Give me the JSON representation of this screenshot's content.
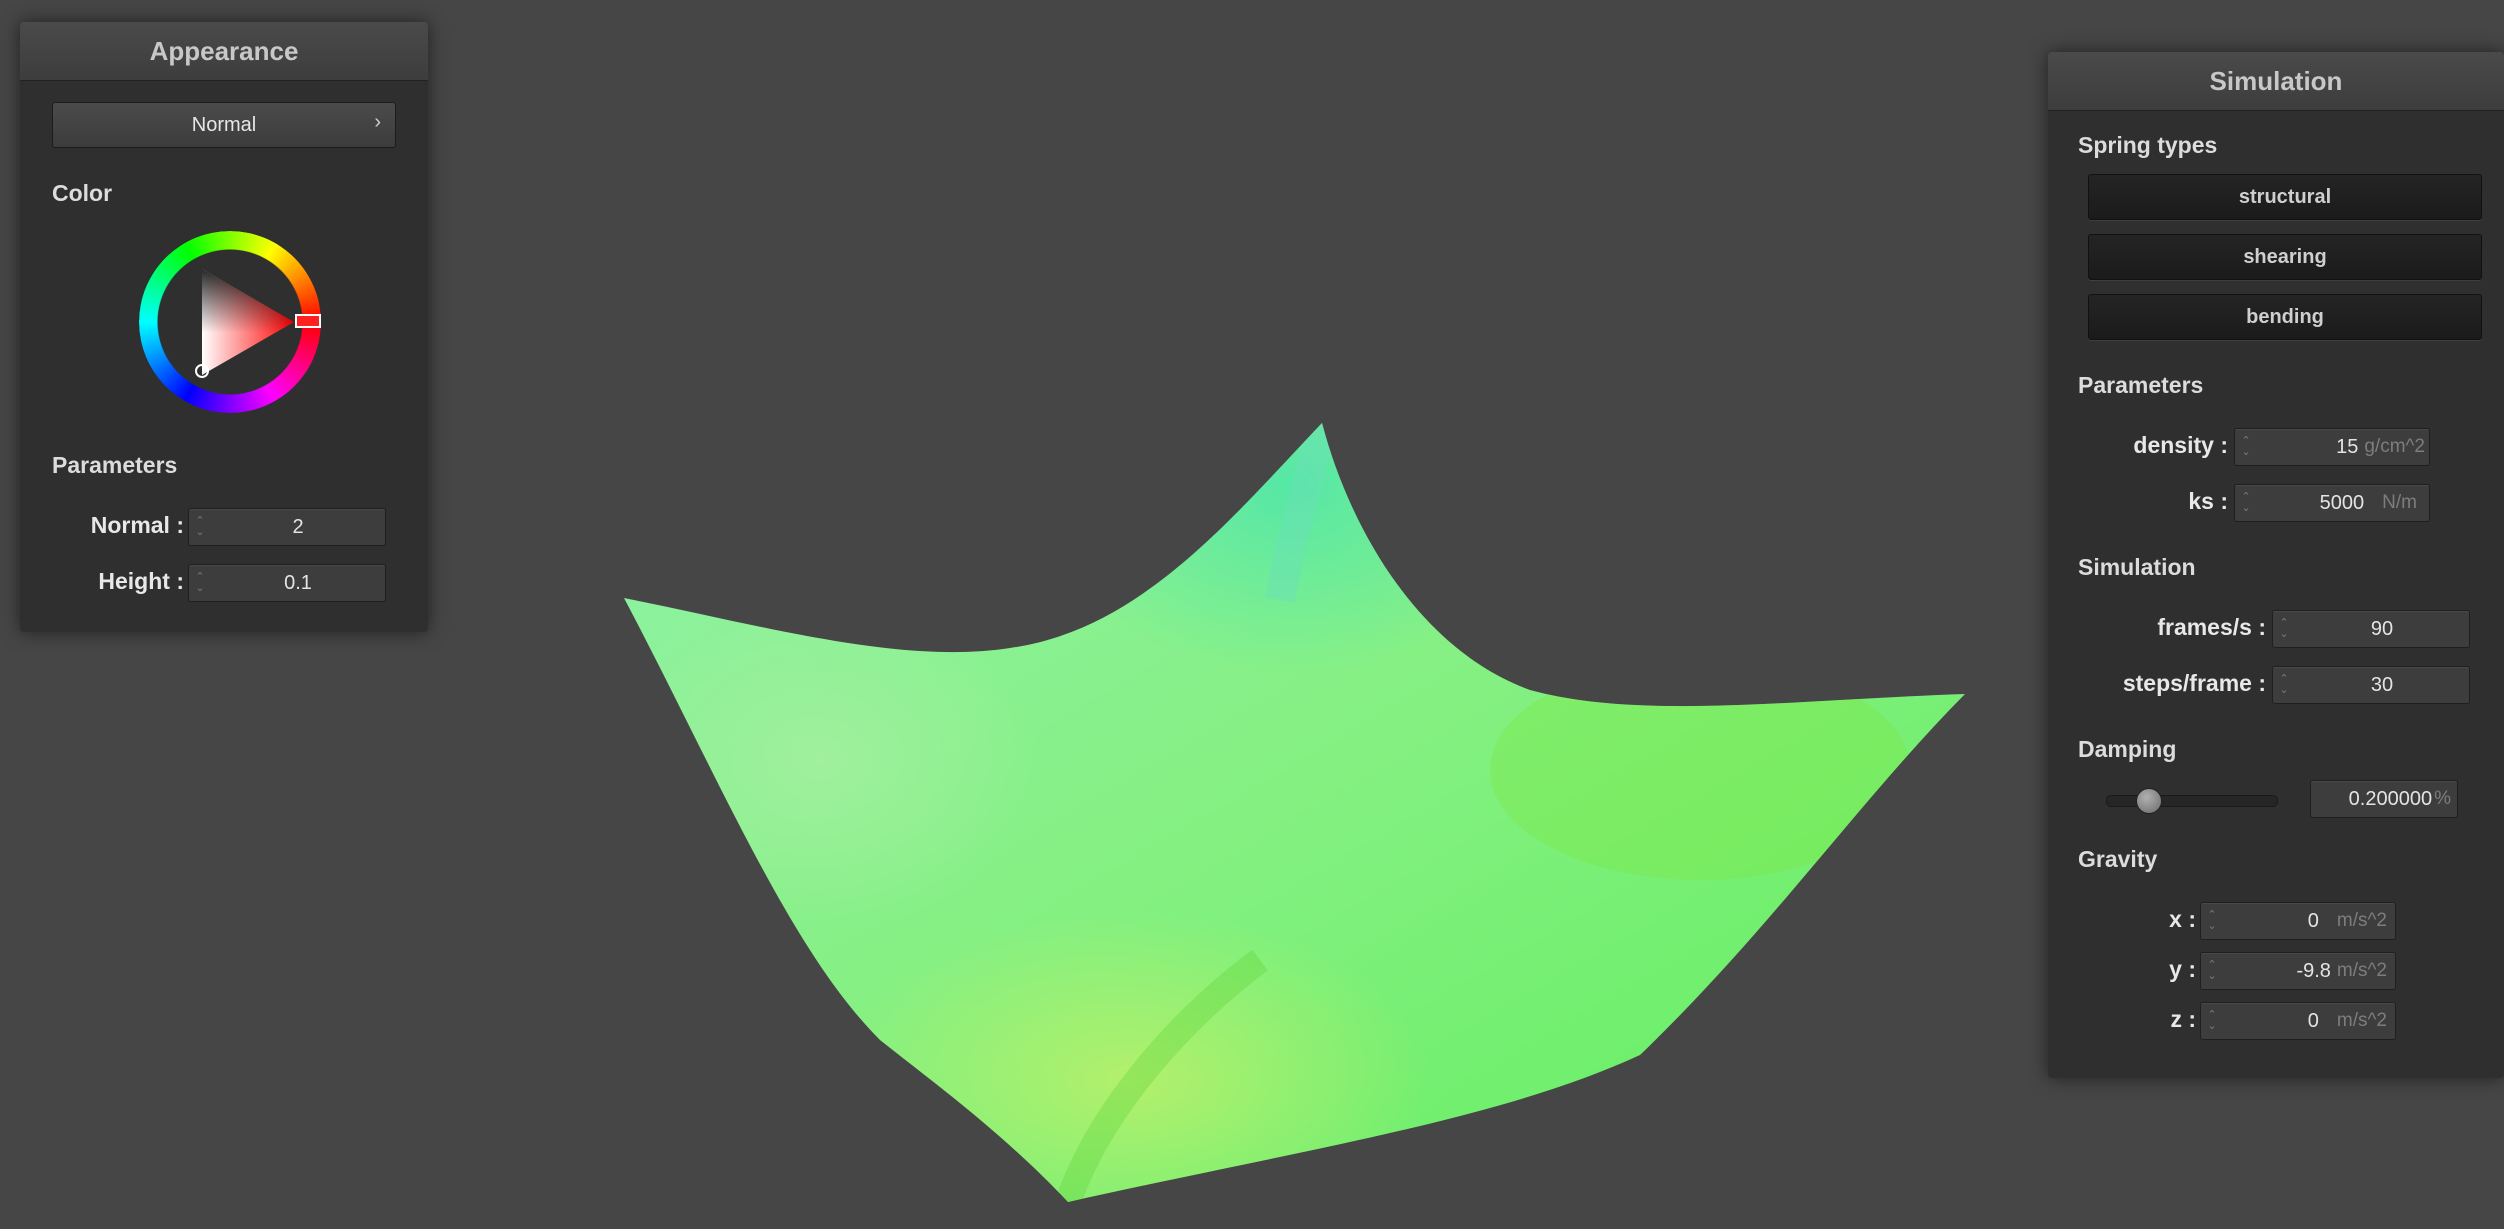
{
  "appearance": {
    "title": "Appearance",
    "shader_label": "Normal",
    "color_label": "Color",
    "params_label": "Parameters",
    "normal_label": "Normal :",
    "normal_value": "2",
    "height_label": "Height :",
    "height_value": "0.1"
  },
  "simulation": {
    "title": "Simulation",
    "spring_types_label": "Spring types",
    "spring_types": [
      "structural",
      "shearing",
      "bending"
    ],
    "params_label": "Parameters",
    "density_label": "density :",
    "density_value": "15",
    "density_unit": "g/cm^2",
    "ks_label": "ks :",
    "ks_value": "5000",
    "ks_unit": "N/m",
    "sim_label": "Simulation",
    "fps_label": "frames/s :",
    "fps_value": "90",
    "steps_label": "steps/frame :",
    "steps_value": "30",
    "damping_label": "Damping",
    "damping_value": "0.200000",
    "damping_unit": "%",
    "damping_fraction": 0.2,
    "gravity_label": "Gravity",
    "gx_label": "x :",
    "gx_value": "0",
    "gy_label": "y :",
    "gy_value": "-9.8",
    "gz_label": "z :",
    "gz_value": "0",
    "gravity_unit": "m/s^2"
  },
  "colors": {
    "background": "#464646",
    "panel": "#2f2f2f",
    "selected_color": "#ff0000",
    "cloth_green": "#6df06a"
  }
}
